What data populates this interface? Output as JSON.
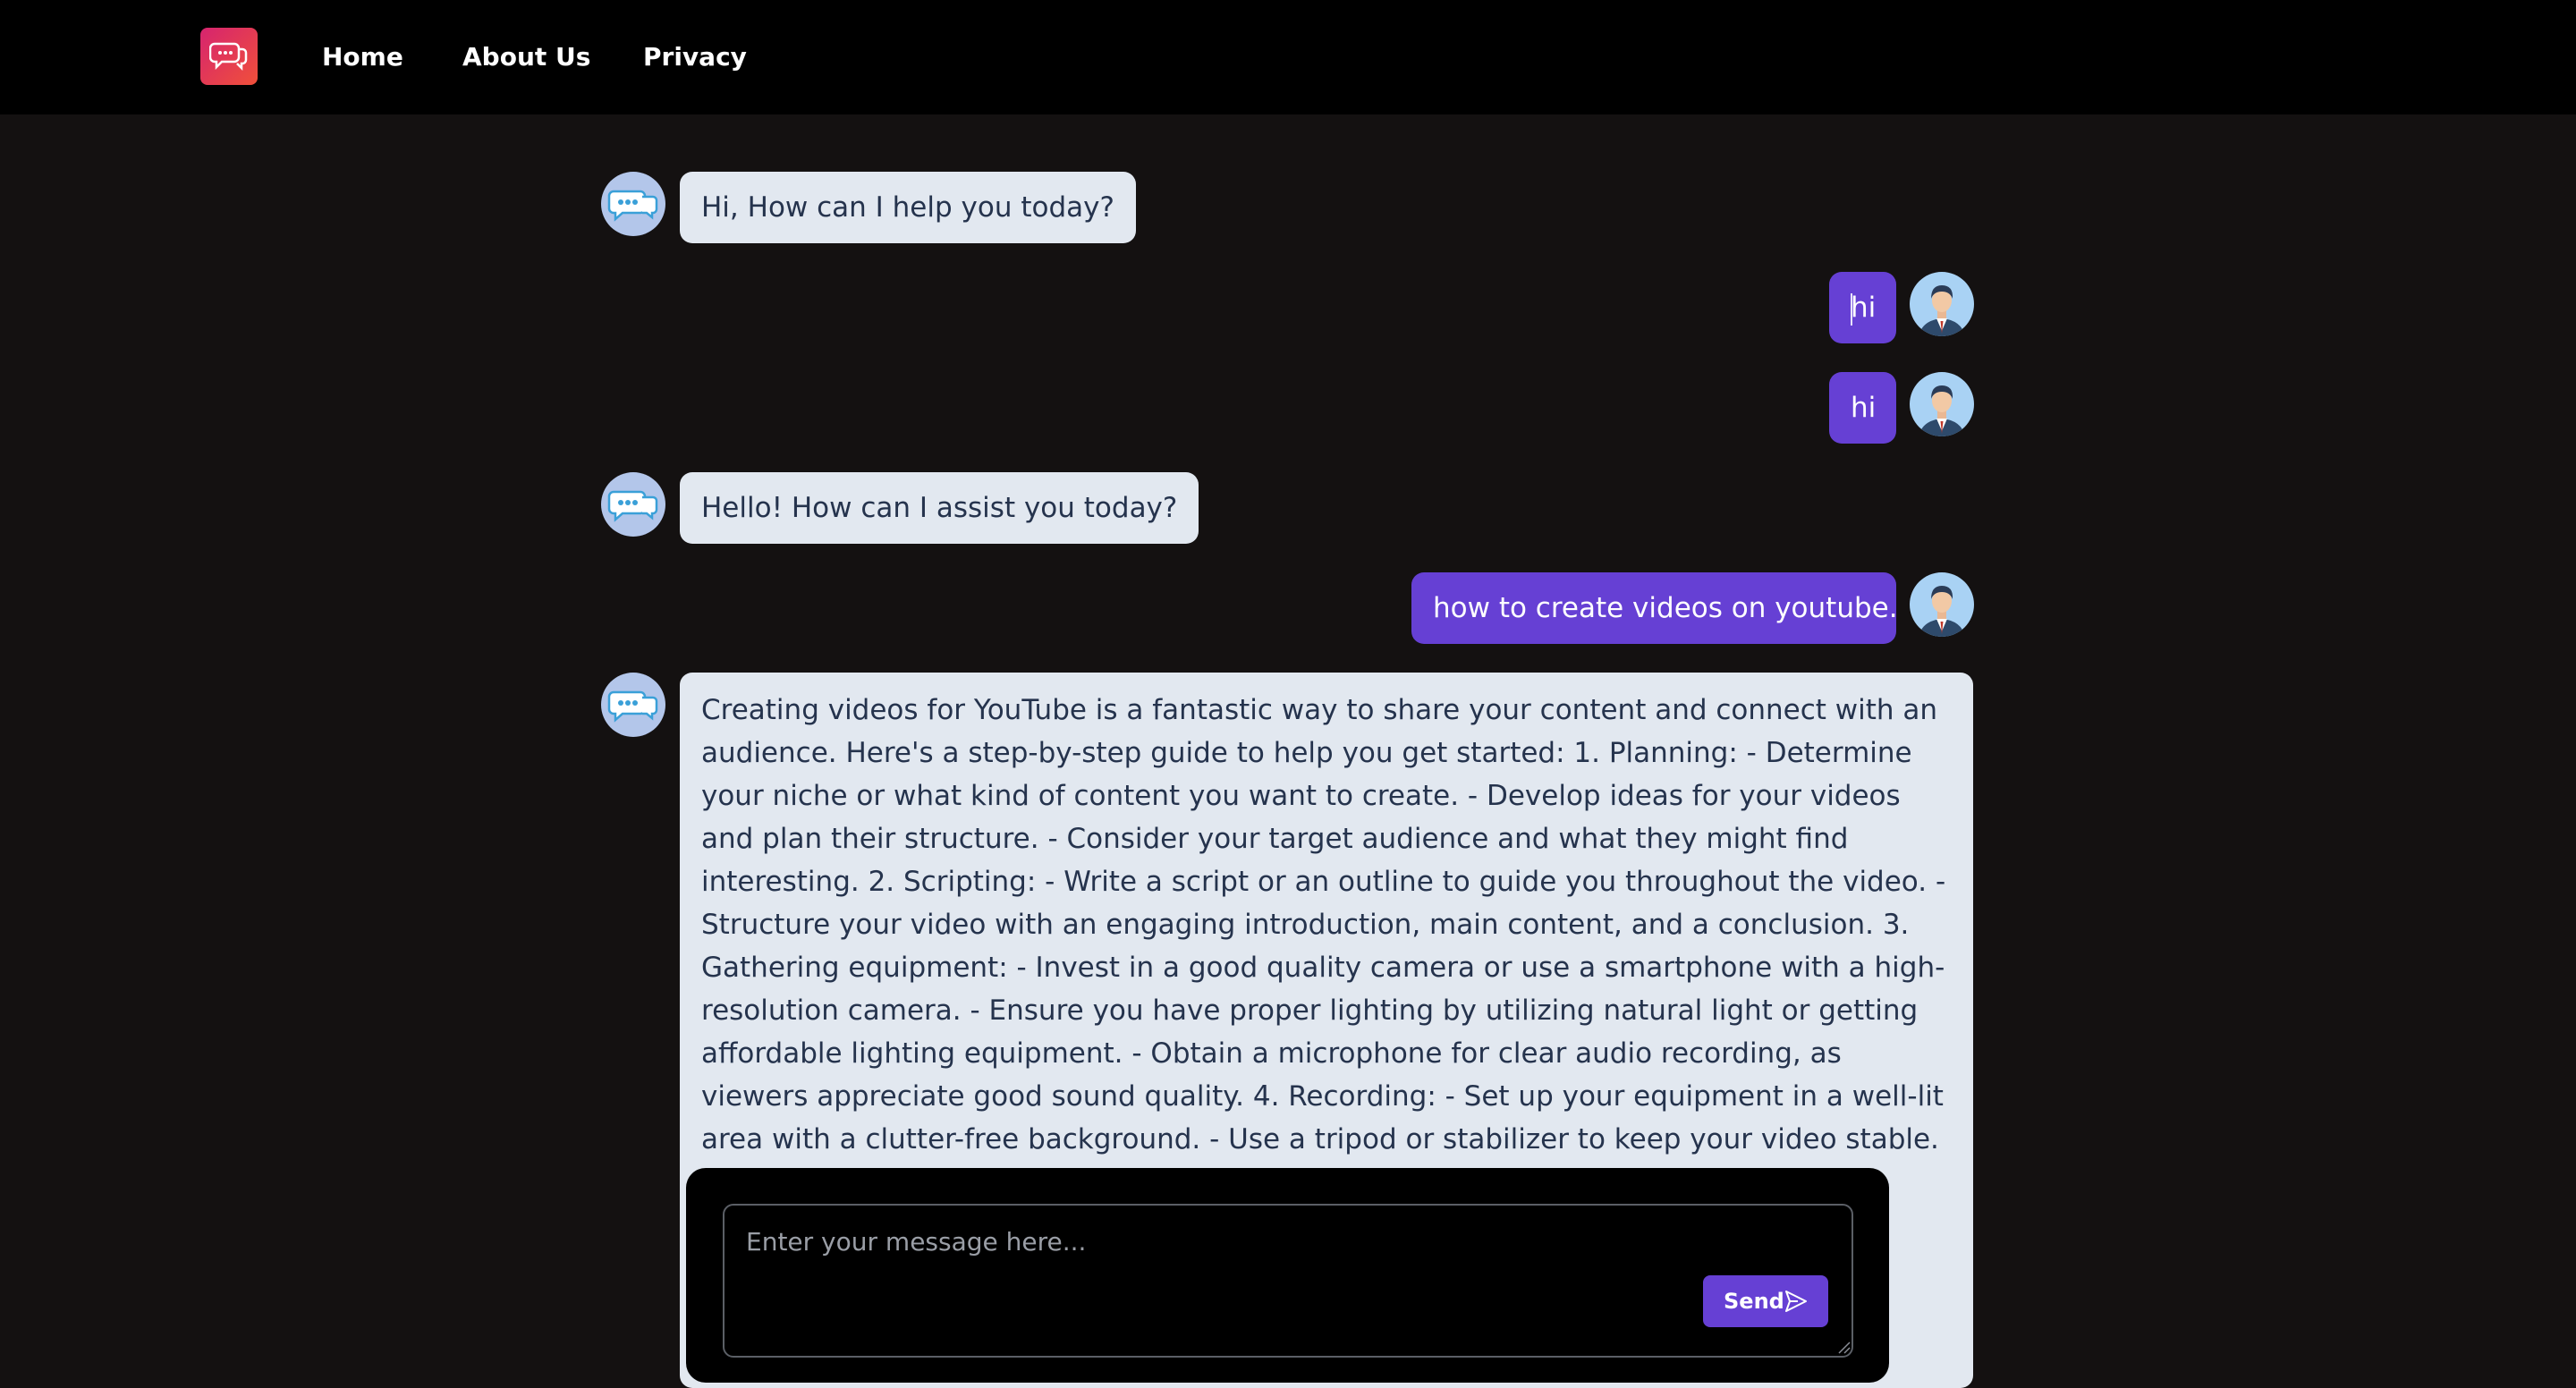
{
  "nav": {
    "logo_icon": "chat-bubbles-icon",
    "links": [
      "Home",
      "About Us",
      "Privacy"
    ]
  },
  "messages": [
    {
      "role": "bot",
      "text": "Hi, How can I help you today?"
    },
    {
      "role": "user",
      "text": "hi"
    },
    {
      "role": "user",
      "text": "hi"
    },
    {
      "role": "bot",
      "text": "Hello! How can I assist you today?"
    },
    {
      "role": "user",
      "text": "how to create videos on youtube."
    },
    {
      "role": "bot",
      "text": "Creating videos for YouTube is a fantastic way to share your content and connect with an audience. Here's a step-by-step guide to help you get started: 1. Planning: - Determine your niche or what kind of content you want to create. - Develop ideas for your videos and plan their structure. - Consider your target audience and what they might find interesting. 2. Scripting: - Write a script or an outline to guide you throughout the video. - Structure your video with an engaging introduction, main content, and a conclusion. 3. Gathering equipment: - Invest in a good quality camera or use a smartphone with a high-resolution camera. - Ensure you have proper lighting by utilizing natural light or getting affordable lighting equipment. - Obtain a microphone for clear audio recording, as viewers appreciate good sound quality. 4. Recording: - Set up your equipment in a well-lit area with a clutter-free background. - Use a tripod or stabilizer to keep your video stable. - Consider using an"
    }
  ],
  "composer": {
    "placeholder": "Enter your message here...",
    "value": "",
    "send_label": "Send",
    "send_icon": "paper-plane-icon"
  },
  "colors": {
    "background": "#141111",
    "navbar": "#000000",
    "user_bubble": "#6640d4",
    "bot_bubble": "#e2e8f0",
    "bot_text": "#25334d",
    "send_button": "#6640d4"
  }
}
